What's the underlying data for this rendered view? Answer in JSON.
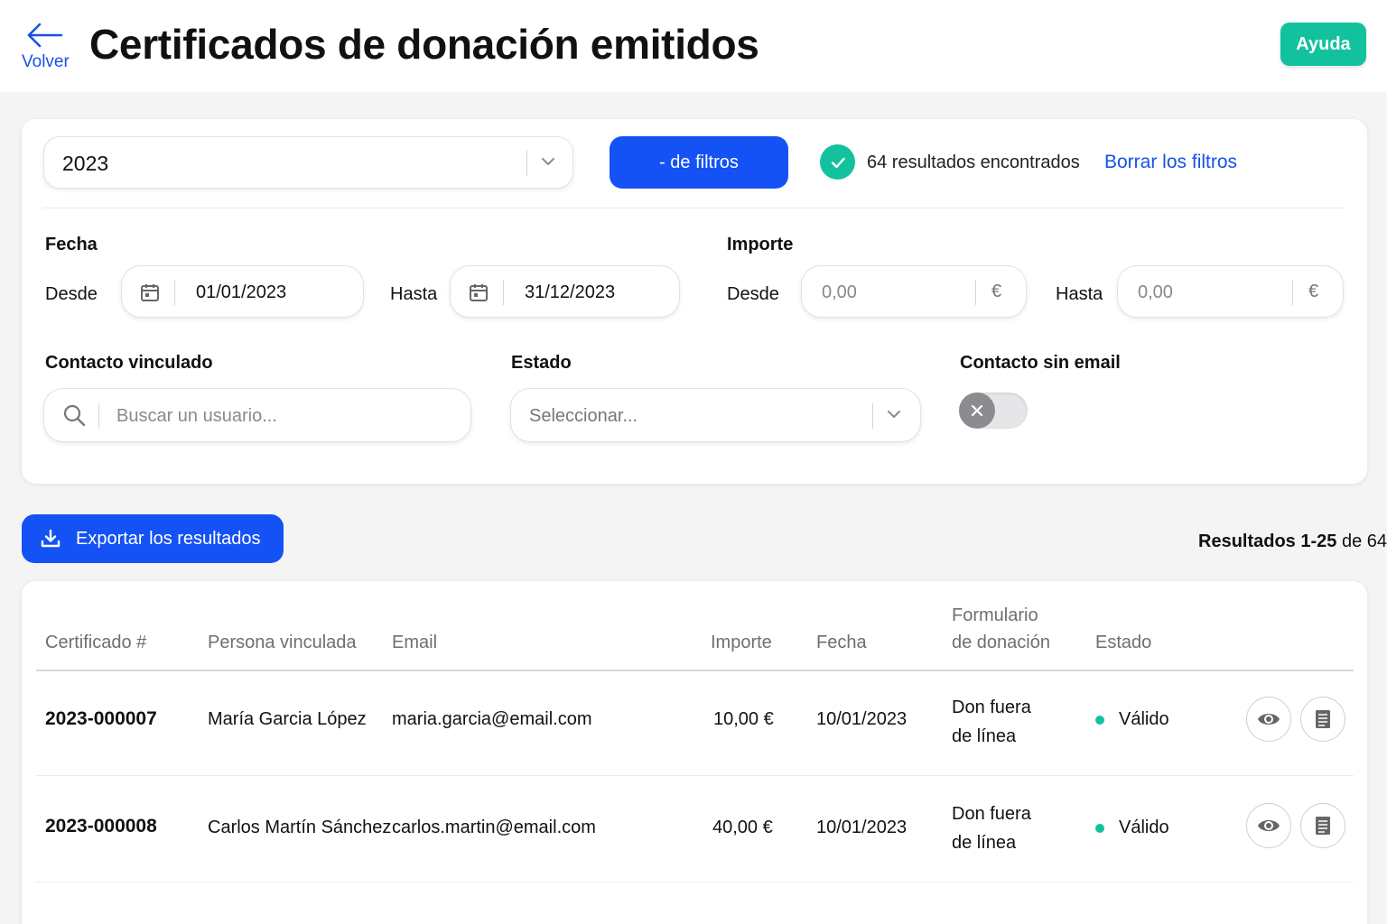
{
  "header": {
    "back_label": "Volver",
    "title": "Certificados de donación emitidos",
    "help_label": "Ayuda"
  },
  "filters": {
    "year_value": "2023",
    "less_filters_label": "- de filtros",
    "results_found": "64 resultados encontrados",
    "clear_filters": "Borrar los filtros",
    "date": {
      "label": "Fecha",
      "from_label": "Desde",
      "from_value": "01/01/2023",
      "to_label": "Hasta",
      "to_value": "31/12/2023"
    },
    "amount": {
      "label": "Importe",
      "from_label": "Desde",
      "from_value": "0,00",
      "to_label": "Hasta",
      "to_value": "0,00",
      "currency": "€"
    },
    "contact": {
      "label": "Contacto vinculado",
      "placeholder": "Buscar un usuario..."
    },
    "state": {
      "label": "Estado",
      "placeholder": "Seleccionar..."
    },
    "no_email": {
      "label": "Contacto sin email",
      "enabled": false
    }
  },
  "export_label": "Exportar los resultados",
  "results_range": {
    "prefix": "Resultados 1-25",
    "suffix": " de 64"
  },
  "table": {
    "columns": {
      "certificate": "Certificado #",
      "person": "Persona vinculada",
      "email": "Email",
      "amount": "Importe",
      "date": "Fecha",
      "form_line1": "Formulario",
      "form_line2": "de donación",
      "state": "Estado"
    },
    "rows": [
      {
        "certificate": "2023-000007",
        "person": "María Garcia López",
        "email": "maria.garcia@email.com",
        "amount": "10,00 €",
        "date": "10/01/2023",
        "form_line1": "Don fuera",
        "form_line2": "de línea",
        "state": "Válido"
      },
      {
        "certificate": "2023-000008",
        "person": "Carlos Martín Sánchez",
        "email": "carlos.martin@email.com",
        "amount": "40,00 €",
        "date": "10/01/2023",
        "form_line1": "Don fuera",
        "form_line2": "de línea",
        "state": "Válido"
      }
    ]
  },
  "colors": {
    "primary": "#1552f5",
    "accent": "#12c29e",
    "link": "#1552e8"
  }
}
